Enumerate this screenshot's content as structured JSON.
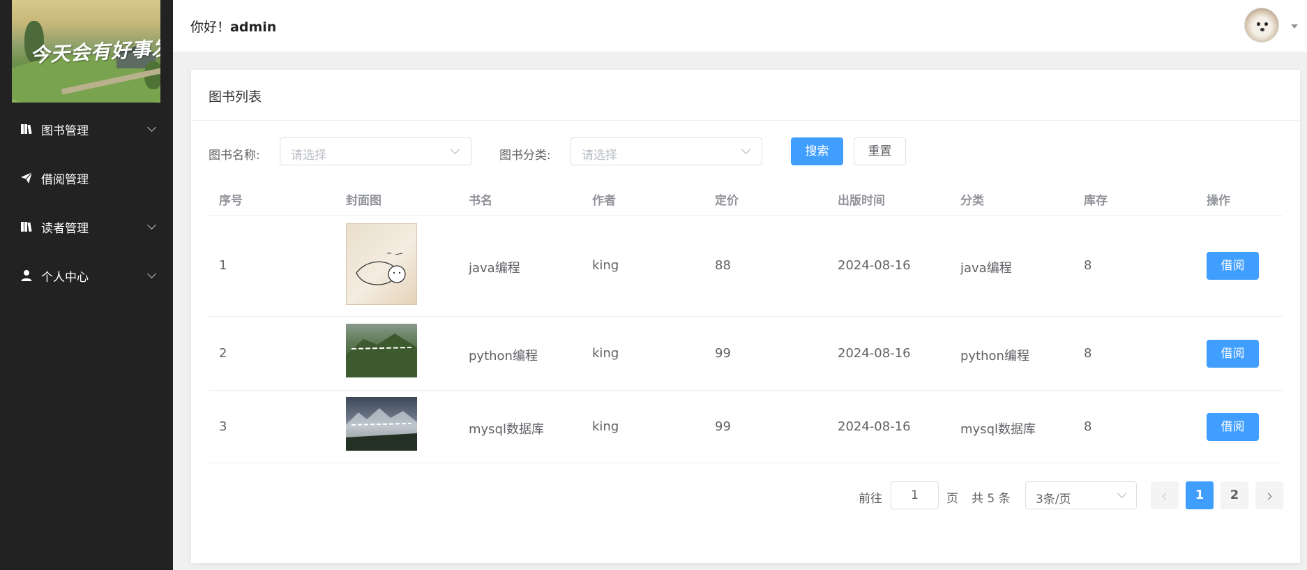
{
  "sidebar": {
    "logo_text": "今天会有好事发生",
    "items": [
      {
        "label": "图书管理",
        "icon": "books-icon",
        "expandable": true
      },
      {
        "label": "借阅管理",
        "icon": "paper-plane-icon",
        "expandable": false
      },
      {
        "label": "读者管理",
        "icon": "books-icon",
        "expandable": true
      },
      {
        "label": "个人中心",
        "icon": "user-icon",
        "expandable": true
      }
    ]
  },
  "header": {
    "greeting": "你好！",
    "username": "admin",
    "avatar_icon": "user-avatar-dog"
  },
  "card": {
    "title": "图书列表"
  },
  "filters": {
    "name_label": "图书名称:",
    "name_placeholder": "请选择",
    "category_label": "图书分类:",
    "category_placeholder": "请选择",
    "search_label": "搜索",
    "reset_label": "重置"
  },
  "table": {
    "headers": [
      "序号",
      "封面图",
      "书名",
      "作者",
      "定价",
      "出版时间",
      "分类",
      "库存",
      "操作"
    ],
    "rows": [
      {
        "index": "1",
        "title": "java编程",
        "author": "king",
        "price": "88",
        "date": "2024-08-16",
        "category": "java编程",
        "stock": "8",
        "action": "借阅"
      },
      {
        "index": "2",
        "title": "python编程",
        "author": "king",
        "price": "99",
        "date": "2024-08-16",
        "category": "python编程",
        "stock": "8",
        "action": "借阅"
      },
      {
        "index": "3",
        "title": "mysql数据库",
        "author": "king",
        "price": "99",
        "date": "2024-08-16",
        "category": "mysql数据库",
        "stock": "8",
        "action": "借阅"
      }
    ]
  },
  "pagination": {
    "goto_label": "前往",
    "goto_value": "1",
    "page_label": "页",
    "total_text": "共 5 条",
    "page_size": "3条/页",
    "pages": [
      "1",
      "2"
    ],
    "current_page": "1"
  },
  "colors": {
    "primary": "#409eff",
    "sidebar_bg": "#222222"
  }
}
